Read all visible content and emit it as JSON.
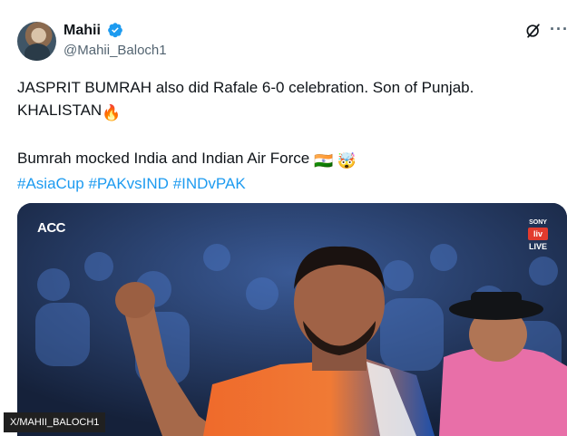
{
  "author": {
    "display_name": "Mahii",
    "handle": "@Mahii_Baloch1",
    "verified": true
  },
  "icons": {
    "verified": "verified-badge-icon",
    "grok": "grok-icon",
    "more": "more-options-icon"
  },
  "tweet": {
    "line1": "JASPRIT BUMRAH also did Rafale 6-0 celebration. Son of Punjab.",
    "line2": "KHALISTAN",
    "line2_emoji": "🔥",
    "line3": "Bumrah mocked India and Indian Air Force",
    "line3_emoji_1": "🇮🇳",
    "line3_emoji_2": "🤯",
    "hashtags": [
      "#AsiaCup",
      "#PAKvsIND",
      "#INDvPAK"
    ]
  },
  "media": {
    "broadcaster_logo": "ACC",
    "channel_brand": "SONY",
    "channel_box": "liv",
    "live_label": "LIVE"
  },
  "credit": "X/MAHII_BALOCH1",
  "colors": {
    "accent_blue": "#1d9bf0",
    "text_primary": "#0f1419",
    "text_secondary": "#536471",
    "jersey_orange": "#ef6a2b",
    "jersey_blue": "#1f4fa8",
    "umpire_pink": "#e86fa8"
  }
}
